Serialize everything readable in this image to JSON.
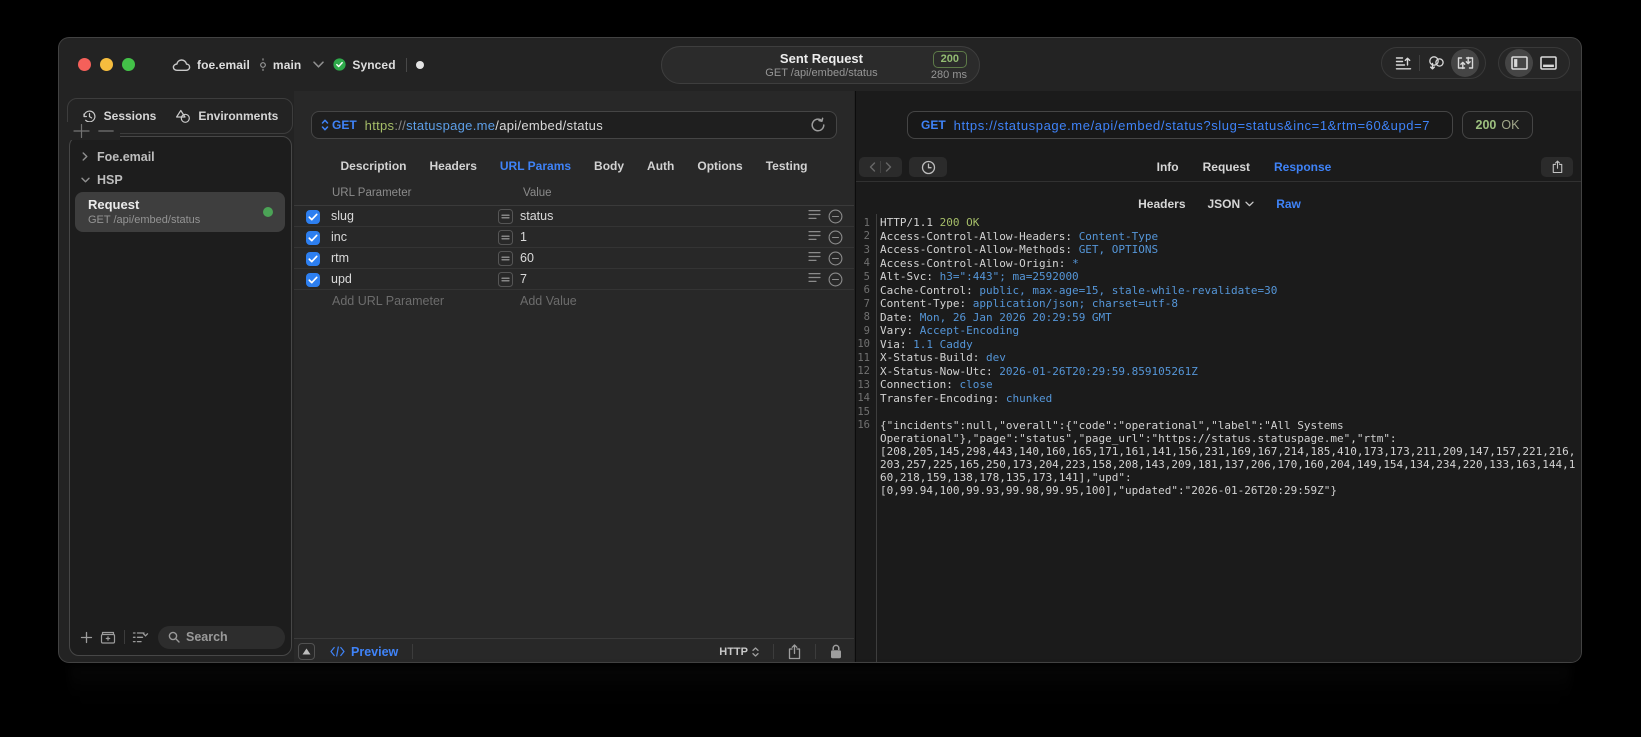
{
  "titlebar": {
    "workspace": "foe.email",
    "branch": "main",
    "sync_label": "Synced",
    "toast": {
      "title": "Sent Request",
      "subtitle": "GET /api/embed/status",
      "status_code": "200",
      "duration": "280 ms"
    }
  },
  "sidebar": {
    "tabs": [
      {
        "label": "Sessions",
        "icon": "history-icon"
      },
      {
        "label": "Environments",
        "icon": "shapes-icon"
      }
    ],
    "tree": [
      {
        "label": "Foe.email",
        "expanded": false
      },
      {
        "label": "HSP",
        "expanded": true
      }
    ],
    "request": {
      "name": "Request",
      "subtitle": "GET /api/embed/status"
    },
    "search": {
      "placeholder": "Search"
    }
  },
  "request_panel": {
    "method": "GET",
    "url_parts": {
      "scheme": "https",
      "separator": "://",
      "host": "statuspage.me",
      "path": "/api/embed/status"
    },
    "tabs": [
      "Description",
      "Headers",
      "URL Params",
      "Body",
      "Auth",
      "Options",
      "Testing"
    ],
    "active_tab": "URL Params",
    "params": {
      "columns": [
        "URL Parameter",
        "Value"
      ],
      "rows": [
        {
          "enabled": true,
          "name": "slug",
          "value": "status"
        },
        {
          "enabled": true,
          "name": "inc",
          "value": "1"
        },
        {
          "enabled": true,
          "name": "rtm",
          "value": "60"
        },
        {
          "enabled": true,
          "name": "upd",
          "value": "7"
        }
      ],
      "add_name_placeholder": "Add URL Parameter",
      "add_value_placeholder": "Add Value"
    },
    "footer": {
      "preview_label": "Preview",
      "protocol": "HTTP"
    }
  },
  "response_panel": {
    "method": "GET",
    "url": "https://statuspage.me/api/embed/status?slug=status&inc=1&rtm=60&upd=7",
    "status_code": "200",
    "status_text": "OK",
    "tabs": [
      "Info",
      "Request",
      "Response"
    ],
    "active_tab": "Response",
    "subtabs": [
      "Headers",
      "JSON",
      "Raw"
    ],
    "active_subtab": "Raw",
    "raw": {
      "status_line": {
        "protocol": "HTTP/1.1",
        "status": "200 OK"
      },
      "headers": [
        [
          "Access-Control-Allow-Headers",
          "Content-Type"
        ],
        [
          "Access-Control-Allow-Methods",
          "GET, OPTIONS"
        ],
        [
          "Access-Control-Allow-Origin",
          "*"
        ],
        [
          "Alt-Svc",
          "h3=\":443\"; ma=2592000"
        ],
        [
          "Cache-Control",
          "public, max-age=15, stale-while-revalidate=30"
        ],
        [
          "Content-Type",
          "application/json; charset=utf-8"
        ],
        [
          "Date",
          "Mon, 26 Jan 2026 20:29:59 GMT"
        ],
        [
          "Vary",
          "Accept-Encoding"
        ],
        [
          "Via",
          "1.1 Caddy"
        ],
        [
          "X-Status-Build",
          "dev"
        ],
        [
          "X-Status-Now-Utc",
          "2026-01-26T20:29:59.859105261Z"
        ],
        [
          "Connection",
          "close"
        ],
        [
          "Transfer-Encoding",
          "chunked"
        ]
      ],
      "body": "{\"incidents\":null,\"overall\":{\"code\":\"operational\",\"label\":\"All Systems Operational\"},\"page\":\"status\",\"page_url\":\"https://status.statuspage.me\",\"rtm\":[208,205,145,298,443,140,160,165,171,161,141,156,231,169,167,214,185,410,173,173,211,209,147,157,221,216,203,257,225,165,250,173,204,223,158,208,143,209,181,137,206,170,160,204,149,154,134,234,220,133,163,144,160,218,159,138,178,135,173,141],\"upd\":[0,99.94,100,99.93,99.98,99.95,100],\"updated\":\"2026-01-26T20:29:59Z\"}"
    }
  }
}
